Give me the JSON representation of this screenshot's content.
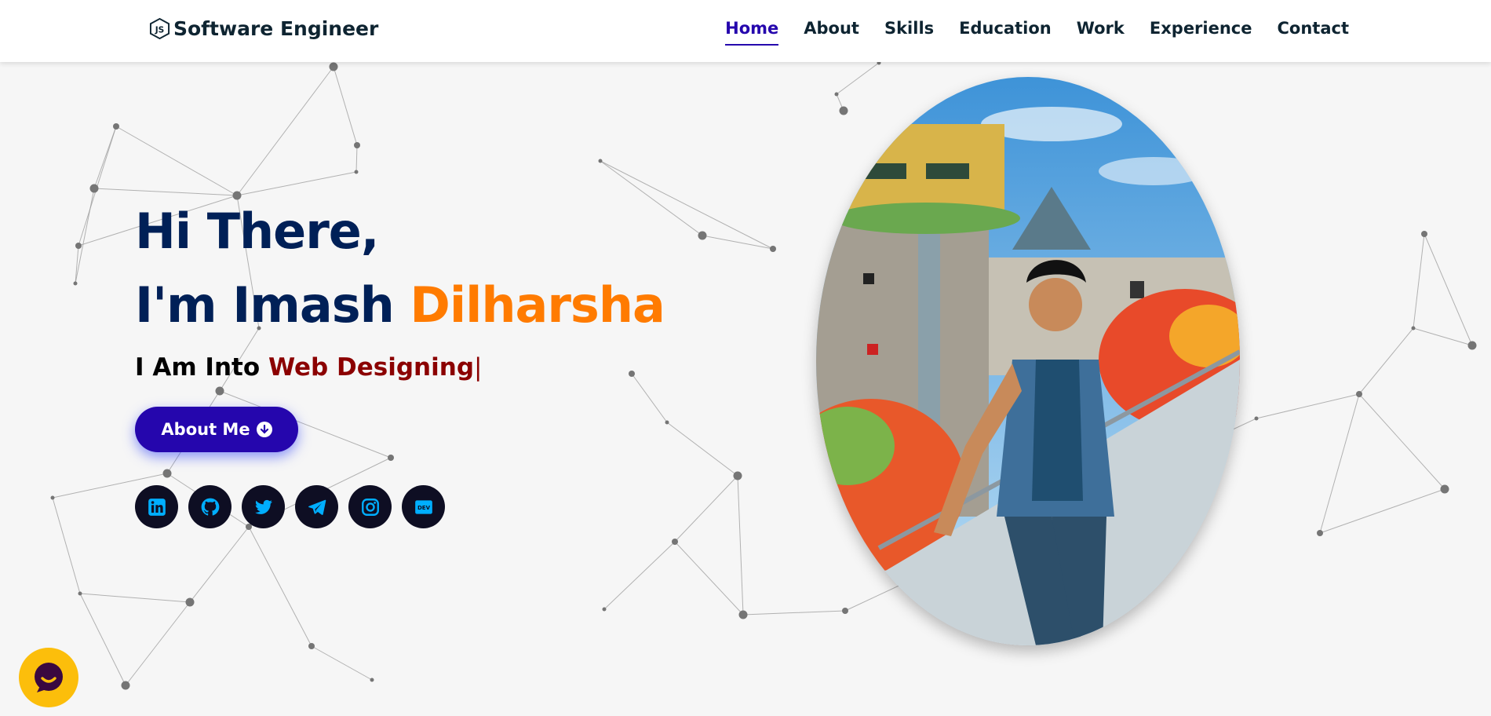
{
  "header": {
    "logo_text": "Software Engineer",
    "logo_icon": "nodejs-icon",
    "nav": [
      {
        "label": "Home",
        "active": true
      },
      {
        "label": "About"
      },
      {
        "label": "Skills"
      },
      {
        "label": "Education"
      },
      {
        "label": "Work"
      },
      {
        "label": "Experience"
      },
      {
        "label": "Contact"
      }
    ]
  },
  "hero": {
    "greeting": "Hi There,",
    "intro_prefix": "I'm Imash",
    "name": "Dilharsha",
    "typing_prefix": "I Am Into",
    "typing_text": "Web Designing",
    "cursor": "|",
    "button_label": "About Me"
  },
  "socials": [
    {
      "icon": "linkedin-icon"
    },
    {
      "icon": "github-icon"
    },
    {
      "icon": "twitter-icon"
    },
    {
      "icon": "telegram-icon"
    },
    {
      "icon": "instagram-icon"
    },
    {
      "icon": "dev-icon",
      "text": "DEV"
    }
  ],
  "colors": {
    "heading": "#002057",
    "accent_name": "#ff7b00",
    "typed_text": "#8b0000",
    "button": "#2506ad",
    "social_bg": "#0e0e23",
    "social_icon": "#00aeff",
    "chat": "#fcbe0b"
  },
  "chat_widget": {
    "icon": "chat-bubble-icon"
  }
}
